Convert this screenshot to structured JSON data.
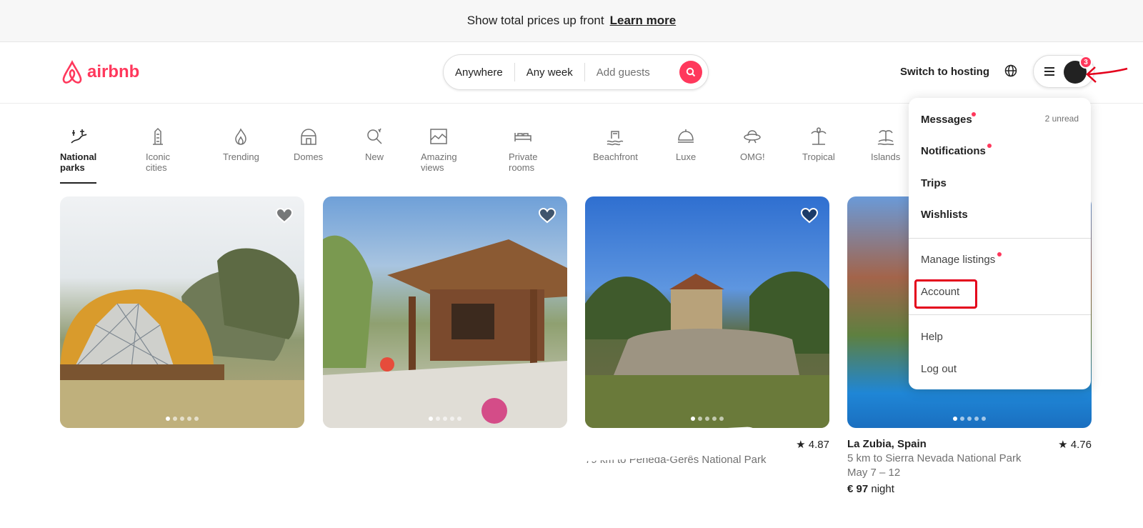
{
  "banner": {
    "text": "Show total prices up front",
    "link": "Learn more"
  },
  "header": {
    "logo": "airbnb",
    "search": {
      "where": "Anywhere",
      "when": "Any week",
      "guests": "Add guests"
    },
    "switch_hosting": "Switch to hosting",
    "notification_count": "3"
  },
  "categories": [
    {
      "label": "National parks",
      "icon": "national-parks-icon"
    },
    {
      "label": "Iconic cities",
      "icon": "iconic-cities-icon"
    },
    {
      "label": "Trending",
      "icon": "flame-icon"
    },
    {
      "label": "Domes",
      "icon": "dome-icon"
    },
    {
      "label": "New",
      "icon": "new-icon"
    },
    {
      "label": "Amazing views",
      "icon": "views-icon"
    },
    {
      "label": "Private rooms",
      "icon": "bed-icon"
    },
    {
      "label": "Beachfront",
      "icon": "beach-icon"
    },
    {
      "label": "Luxe",
      "icon": "luxe-icon"
    },
    {
      "label": "OMG!",
      "icon": "ufo-icon"
    },
    {
      "label": "Tropical",
      "icon": "palm-icon"
    },
    {
      "label": "Islands",
      "icon": "island-icon"
    }
  ],
  "listings": [
    {
      "title": "",
      "rating": "",
      "sub": "",
      "dates": "",
      "price": ""
    },
    {
      "title": "",
      "rating": "",
      "sub": "",
      "dates": "",
      "price": ""
    },
    {
      "title": "",
      "rating": "4.87",
      "sub": "79 km to Peneda-Gerês National Park",
      "dates": "",
      "price": ""
    },
    {
      "title": "La Zubia, Spain",
      "rating": "4.76",
      "sub": "5 km to Sierra Nevada National Park",
      "dates": "May 7 – 12",
      "price": "€ 97",
      "price_unit": "night"
    }
  ],
  "menu": {
    "messages": "Messages",
    "messages_unread": "2 unread",
    "notifications": "Notifications",
    "trips": "Trips",
    "wishlists": "Wishlists",
    "manage_listings": "Manage listings",
    "account": "Account",
    "help": "Help",
    "logout": "Log out"
  },
  "colors": {
    "brand": "#ff385c",
    "annotation": "#e4001b"
  }
}
